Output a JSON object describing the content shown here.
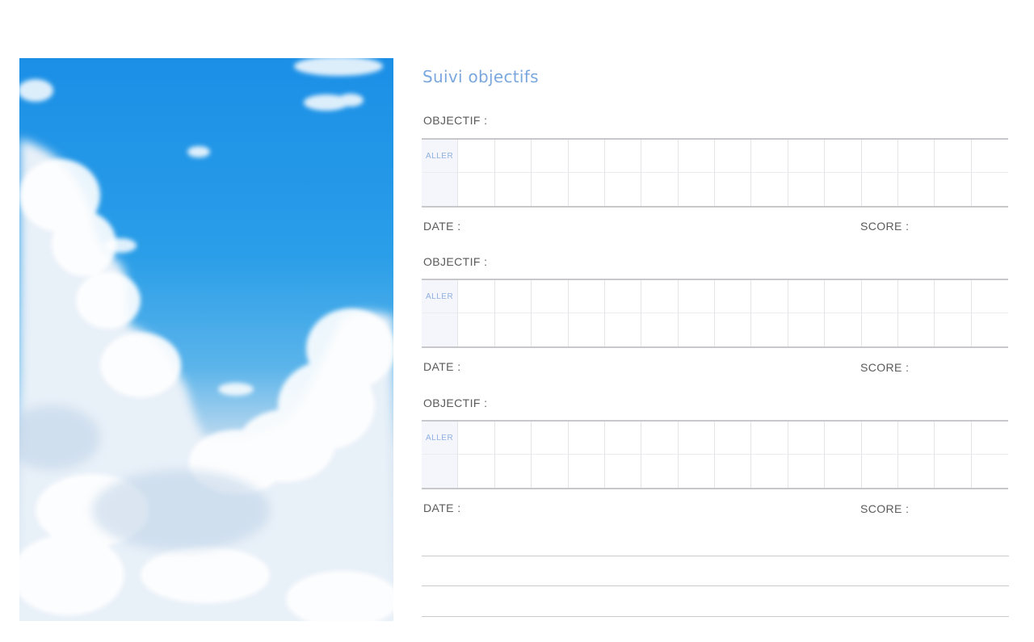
{
  "title": "Suivi objectifs",
  "blocks": [
    {
      "objectif_label": "OBJECTIF :",
      "cell_label": "ALLER",
      "date_label": "DATE :",
      "score_label": "SCORE :"
    },
    {
      "objectif_label": "OBJECTIF :",
      "cell_label": "ALLER",
      "date_label": "DATE :",
      "score_label": "SCORE :"
    },
    {
      "objectif_label": "OBJECTIF :",
      "cell_label": "ALLER",
      "date_label": "DATE :",
      "score_label": "SCORE :"
    }
  ],
  "colors": {
    "title": "#7aa7de",
    "label": "#5a5a5a",
    "grid_border": "#c8c8cc",
    "sky": "#1b8fe6"
  },
  "photo": "sky-with-clouds"
}
